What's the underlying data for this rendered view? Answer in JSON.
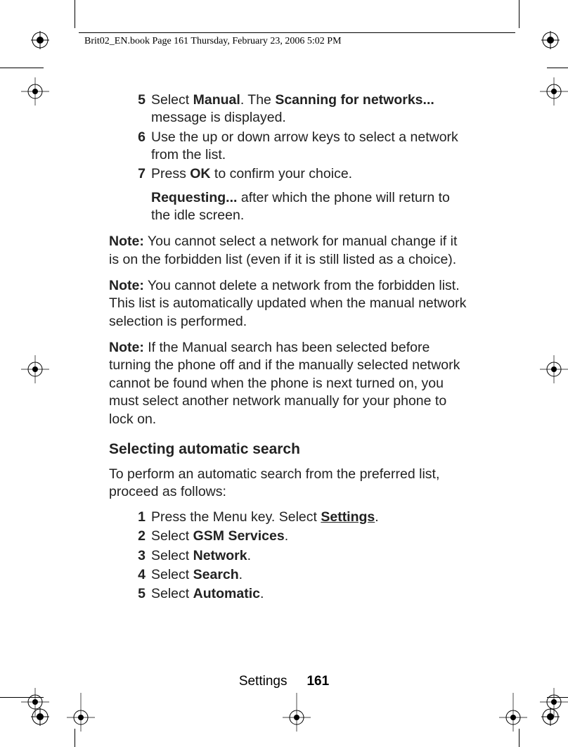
{
  "header": "Brit02_EN.book  Page 161  Thursday, February 23, 2006  5:02 PM",
  "steps_top": [
    {
      "num": "5",
      "pre": "Select ",
      "b1": "Manual",
      "mid": ". The ",
      "b2": "Scanning for networks...",
      "post": " message is displayed."
    },
    {
      "num": "6",
      "text": "Use the up or down arrow keys to select a network from the list."
    },
    {
      "num": "7",
      "pre": "Press ",
      "b1": "OK",
      "post": " to confirm your choice."
    }
  ],
  "sub_para": {
    "b": "Requesting...",
    "rest": " after which the phone will return to the idle screen."
  },
  "notes": [
    {
      "label": "Note:",
      "text": " You cannot select a network for manual change if it is on the forbidden list (even if it is still listed as a choice)."
    },
    {
      "label": "Note:",
      "text": " You cannot delete a network from the forbidden list. This list is automatically updated when the manual network selection is performed."
    },
    {
      "label": "Note:",
      "text": " If the Manual search has been selected before turning the phone off and if the manually selected network cannot be found when the phone is next turned on, you must select another network manually for your phone to lock on."
    }
  ],
  "heading": "Selecting automatic search",
  "intro": "To perform an automatic search from the preferred list, proceed as follows:",
  "steps_bottom": [
    {
      "num": "1",
      "pre": "Press the Menu key. Select ",
      "b1": "Settings",
      "underline": true,
      "post": "."
    },
    {
      "num": "2",
      "pre": "Select ",
      "b1": "GSM Services",
      "post": "."
    },
    {
      "num": "3",
      "pre": "Select ",
      "b1": "Network",
      "post": "."
    },
    {
      "num": "4",
      "pre": "Select ",
      "b1": "Search",
      "post": "."
    },
    {
      "num": "5",
      "pre": "Select ",
      "b1": "Automatic",
      "post": "."
    }
  ],
  "footer": {
    "section": "Settings",
    "page": "161"
  }
}
